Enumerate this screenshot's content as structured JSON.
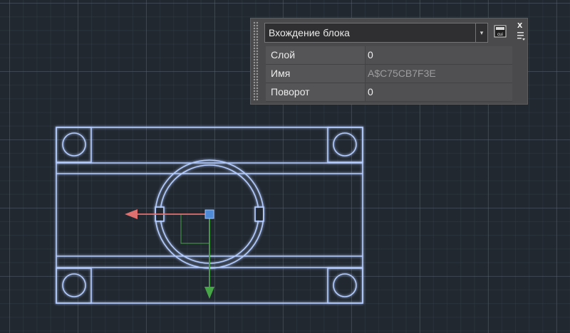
{
  "quick_properties": {
    "object_type": "Вхождение блока",
    "rows": [
      {
        "label": "Слой",
        "value": "0",
        "editable": true
      },
      {
        "label": "Имя",
        "value": "A$C75CB7F3E",
        "editable": false
      },
      {
        "label": "Поворот",
        "value": "0",
        "editable": true
      }
    ],
    "icons": {
      "customize": "cui-icon",
      "close": "close-icon",
      "options": "options-menu-icon",
      "grip": "drag-grip-icon",
      "dropdown": "chevron-down-icon"
    },
    "close_glyph": "x",
    "cui_caption": "cui",
    "dropdown_glyph": "▾"
  },
  "colors": {
    "background": "#212830",
    "geometry": "#aec8ff",
    "geometry_glow": "#3a6cff",
    "ucs_x_axis": "#e07070",
    "ucs_y_axis": "#46a546",
    "grip": "#4f8ad6"
  }
}
